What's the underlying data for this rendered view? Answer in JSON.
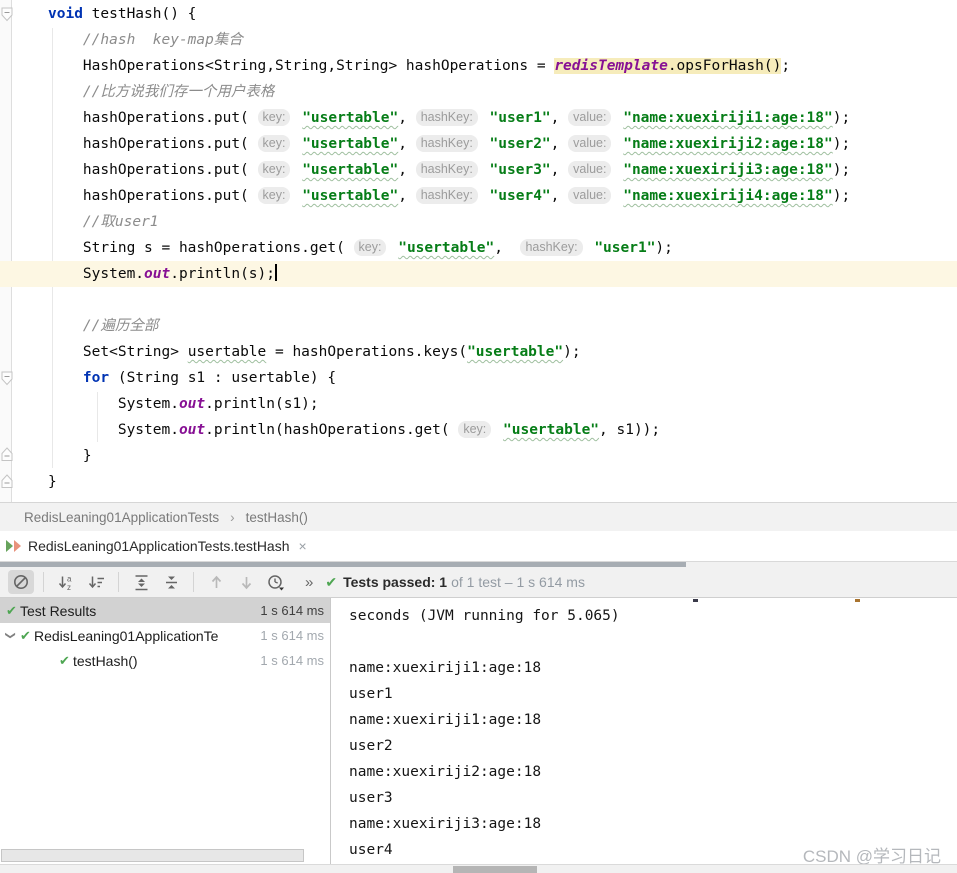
{
  "colors": {
    "keyword": "#0033b3",
    "string": "#067d17",
    "field": "#871094",
    "comment": "#8c8c8c",
    "call_highlight": "#f6ecbb",
    "current_line": "#fdf7e3",
    "test_green": "#4ea652",
    "tab_icon_green": "#67a35c",
    "tab_icon_salmon": "#e8927c"
  },
  "icons": {
    "check": "✔",
    "chevron_down": "❯",
    "close": "×",
    "breadcrumb_separator": "›",
    "more_chevrons": "»"
  },
  "editor": {
    "lines": [
      {
        "tokens": [
          {
            "t": "void",
            "s": "kw"
          },
          {
            "t": " testHash() {",
            "s": "pl"
          }
        ]
      },
      {
        "tokens": [
          {
            "t": "    ",
            "s": "pl"
          },
          {
            "t": "//hash  key-map集合",
            "s": "cm"
          }
        ]
      },
      {
        "tokens": [
          {
            "t": "    HashOperations<String,String,String> hashOperations = ",
            "s": "pl"
          },
          {
            "t": "redisTemplate",
            "s": "field hl"
          },
          {
            "t": ".opsForHash()",
            "s": "pl hl"
          },
          {
            "t": ";",
            "s": "pl"
          }
        ]
      },
      {
        "tokens": [
          {
            "t": "    ",
            "s": "pl"
          },
          {
            "t": "//比方说我们存一个用户表格",
            "s": "cm"
          }
        ]
      },
      {
        "tokens": [
          {
            "t": "    hashOperations.put( ",
            "s": "pl"
          },
          {
            "t": "key:",
            "s": "hint"
          },
          {
            "t": " ",
            "s": "pl"
          },
          {
            "t": "\"usertable\"",
            "s": "str sq"
          },
          {
            "t": ", ",
            "s": "pl"
          },
          {
            "t": "hashKey:",
            "s": "hint"
          },
          {
            "t": " ",
            "s": "pl"
          },
          {
            "t": "\"user1\"",
            "s": "str"
          },
          {
            "t": ", ",
            "s": "pl"
          },
          {
            "t": "value:",
            "s": "hint"
          },
          {
            "t": " ",
            "s": "pl"
          },
          {
            "t": "\"name:xuexiriji1:age:18\"",
            "s": "str sq"
          },
          {
            "t": ");",
            "s": "pl"
          }
        ]
      },
      {
        "tokens": [
          {
            "t": "    hashOperations.put( ",
            "s": "pl"
          },
          {
            "t": "key:",
            "s": "hint"
          },
          {
            "t": " ",
            "s": "pl"
          },
          {
            "t": "\"usertable\"",
            "s": "str sq"
          },
          {
            "t": ", ",
            "s": "pl"
          },
          {
            "t": "hashKey:",
            "s": "hint"
          },
          {
            "t": " ",
            "s": "pl"
          },
          {
            "t": "\"user2\"",
            "s": "str"
          },
          {
            "t": ", ",
            "s": "pl"
          },
          {
            "t": "value:",
            "s": "hint"
          },
          {
            "t": " ",
            "s": "pl"
          },
          {
            "t": "\"name:xuexiriji2:age:18\"",
            "s": "str sq"
          },
          {
            "t": ");",
            "s": "pl"
          }
        ]
      },
      {
        "tokens": [
          {
            "t": "    hashOperations.put( ",
            "s": "pl"
          },
          {
            "t": "key:",
            "s": "hint"
          },
          {
            "t": " ",
            "s": "pl"
          },
          {
            "t": "\"usertable\"",
            "s": "str sq"
          },
          {
            "t": ", ",
            "s": "pl"
          },
          {
            "t": "hashKey:",
            "s": "hint"
          },
          {
            "t": " ",
            "s": "pl"
          },
          {
            "t": "\"user3\"",
            "s": "str"
          },
          {
            "t": ", ",
            "s": "pl"
          },
          {
            "t": "value:",
            "s": "hint"
          },
          {
            "t": " ",
            "s": "pl"
          },
          {
            "t": "\"name:xuexiriji3:age:18\"",
            "s": "str sq"
          },
          {
            "t": ");",
            "s": "pl"
          }
        ]
      },
      {
        "tokens": [
          {
            "t": "    hashOperations.put( ",
            "s": "pl"
          },
          {
            "t": "key:",
            "s": "hint"
          },
          {
            "t": " ",
            "s": "pl"
          },
          {
            "t": "\"usertable\"",
            "s": "str sq"
          },
          {
            "t": ", ",
            "s": "pl"
          },
          {
            "t": "hashKey:",
            "s": "hint"
          },
          {
            "t": " ",
            "s": "pl"
          },
          {
            "t": "\"user4\"",
            "s": "str"
          },
          {
            "t": ", ",
            "s": "pl"
          },
          {
            "t": "value:",
            "s": "hint"
          },
          {
            "t": " ",
            "s": "pl"
          },
          {
            "t": "\"name:xuexiriji4:age:18\"",
            "s": "str sq"
          },
          {
            "t": ");",
            "s": "pl"
          }
        ]
      },
      {
        "tokens": [
          {
            "t": "    ",
            "s": "pl"
          },
          {
            "t": "//取user1",
            "s": "cm"
          }
        ]
      },
      {
        "tokens": [
          {
            "t": "    String s = hashOperations.get( ",
            "s": "pl"
          },
          {
            "t": "key:",
            "s": "hint"
          },
          {
            "t": " ",
            "s": "pl"
          },
          {
            "t": "\"usertable\"",
            "s": "str sq"
          },
          {
            "t": ",  ",
            "s": "pl"
          },
          {
            "t": "hashKey:",
            "s": "hint"
          },
          {
            "t": " ",
            "s": "pl"
          },
          {
            "t": "\"user1\"",
            "s": "str"
          },
          {
            "t": ");",
            "s": "pl"
          }
        ]
      },
      {
        "current": true,
        "tokens": [
          {
            "t": "    System.",
            "s": "pl"
          },
          {
            "t": "out",
            "s": "field"
          },
          {
            "t": ".println(s);",
            "s": "pl"
          },
          {
            "t": "",
            "s": "cursor"
          }
        ]
      },
      {
        "tokens": []
      },
      {
        "tokens": [
          {
            "t": "    ",
            "s": "pl"
          },
          {
            "t": "//遍历全部",
            "s": "cm"
          }
        ]
      },
      {
        "tokens": [
          {
            "t": "    Set<String> ",
            "s": "pl"
          },
          {
            "t": "usertable",
            "s": "pl sq"
          },
          {
            "t": " = hashOperations.keys(",
            "s": "pl"
          },
          {
            "t": "\"usertable\"",
            "s": "str sq"
          },
          {
            "t": ");",
            "s": "pl"
          }
        ]
      },
      {
        "tokens": [
          {
            "t": "    ",
            "s": "pl"
          },
          {
            "t": "for",
            "s": "kw"
          },
          {
            "t": " (String s1 : usertable) {",
            "s": "pl"
          }
        ]
      },
      {
        "tokens": [
          {
            "t": "        System.",
            "s": "pl"
          },
          {
            "t": "out",
            "s": "field"
          },
          {
            "t": ".println(s1);",
            "s": "pl"
          }
        ]
      },
      {
        "tokens": [
          {
            "t": "        System.",
            "s": "pl"
          },
          {
            "t": "out",
            "s": "field"
          },
          {
            "t": ".println(hashOperations.get( ",
            "s": "pl"
          },
          {
            "t": "key:",
            "s": "hint"
          },
          {
            "t": " ",
            "s": "pl"
          },
          {
            "t": "\"usertable\"",
            "s": "str sq"
          },
          {
            "t": ", s1));",
            "s": "pl"
          }
        ]
      },
      {
        "tokens": [
          {
            "t": "    }",
            "s": "pl"
          }
        ]
      },
      {
        "tokens": [
          {
            "t": "}",
            "s": "pl"
          }
        ]
      }
    ]
  },
  "breadcrumb": {
    "class_name": "RedisLeaning01ApplicationTests",
    "separator": "›",
    "method": "testHash()"
  },
  "tab": {
    "label": "RedisLeaning01ApplicationTests.testHash",
    "close": "×"
  },
  "toolbar": {
    "icons": [
      "disable-passed",
      "sort-alphabetically",
      "sort-by-duration",
      "expand-all",
      "collapse-all",
      "previous-occurrence",
      "next-occurrence",
      "test-history",
      "more"
    ]
  },
  "status": {
    "passed": "Tests passed: 1",
    "detail": "of 1 test – 1 s 614 ms"
  },
  "tree": {
    "rows": [
      {
        "label": "Test Results",
        "time": "1 s 614 ms",
        "selected": true
      },
      {
        "label": "RedisLeaning01ApplicationTe",
        "time": "1 s 614 ms",
        "selected": false
      },
      {
        "label": "testHash()",
        "time": "1 s 614 ms",
        "selected": false
      }
    ]
  },
  "console": {
    "lines": [
      "seconds (JVM running for 5.065)",
      "",
      "name:xuexiriji1:age:18",
      "user1",
      "name:xuexiriji1:age:18",
      "user2",
      "name:xuexiriji2:age:18",
      "user3",
      "name:xuexiriji3:age:18",
      "user4"
    ]
  },
  "watermark": {
    "text": "CSDN @学习日记"
  }
}
